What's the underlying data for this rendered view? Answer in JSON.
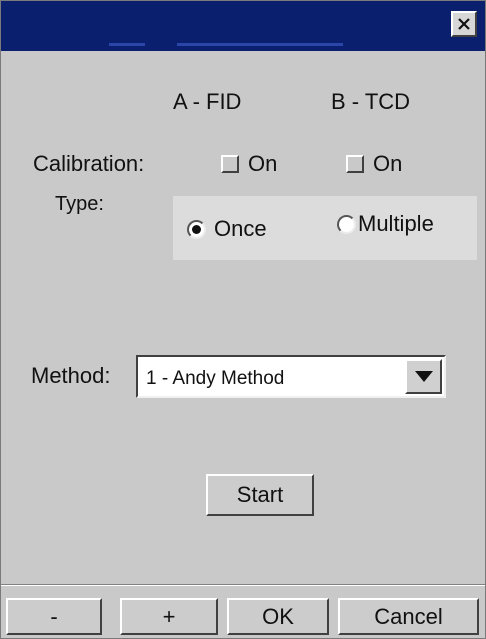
{
  "window": {
    "close_label": "×"
  },
  "columns": {
    "a": "A - FID",
    "b": "B - TCD"
  },
  "calibration": {
    "label": "Calibration:",
    "a_on": {
      "label": "On",
      "checked": false
    },
    "b_on": {
      "label": "On",
      "checked": false
    }
  },
  "type": {
    "label": "Type:",
    "options": [
      {
        "label": "Once",
        "selected": true
      },
      {
        "label": "Multiple",
        "selected": false
      }
    ]
  },
  "method": {
    "label": "Method:",
    "value": "1 - Andy Method"
  },
  "buttons": {
    "start": "Start",
    "minus": "-",
    "plus": "+",
    "ok": "OK",
    "cancel": "Cancel"
  }
}
